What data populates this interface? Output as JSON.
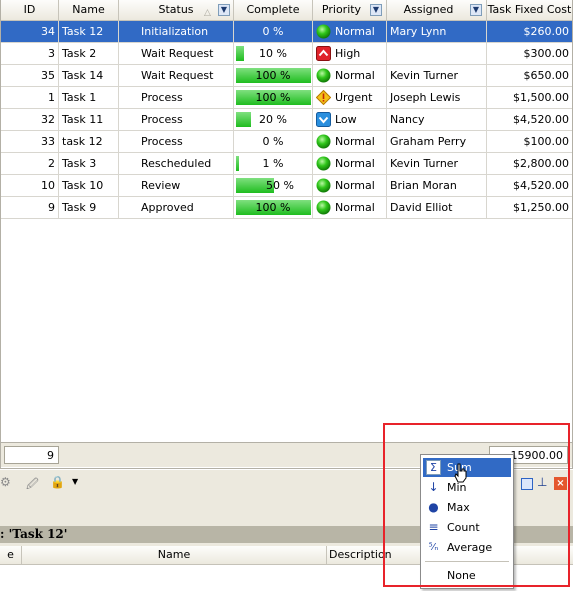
{
  "columns": [
    "ID",
    "Name",
    "Status",
    "Complete",
    "Priority",
    "Assigned",
    "Task Fixed Cost"
  ],
  "rows": [
    {
      "id": "34",
      "name": "Task 12",
      "status": "Initialization",
      "complete": "0 %",
      "pct": 0,
      "priority": "Normal",
      "pri_icon": "green-ball",
      "assigned": "Mary Lynn",
      "cost": "$260.00",
      "selected": true
    },
    {
      "id": "3",
      "name": "Task 2",
      "status": "Wait Request",
      "complete": "10 %",
      "pct": 10,
      "priority": "High",
      "pri_icon": "red-up-arrow",
      "assigned": "",
      "cost": "$300.00"
    },
    {
      "id": "35",
      "name": "Task 14",
      "status": "Wait Request",
      "complete": "100 %",
      "pct": 100,
      "priority": "Normal",
      "pri_icon": "green-ball",
      "assigned": "Kevin Turner",
      "cost": "$650.00"
    },
    {
      "id": "1",
      "name": "Task 1",
      "status": "Process",
      "complete": "100 %",
      "pct": 100,
      "priority": "Urgent",
      "pri_icon": "warning-diamond",
      "assigned": "Joseph Lewis",
      "cost": "$1,500.00"
    },
    {
      "id": "32",
      "name": "Task 11",
      "status": "Process",
      "complete": "20 %",
      "pct": 20,
      "priority": "Low",
      "pri_icon": "blue-down-arrow",
      "assigned": "Nancy",
      "cost": "$4,520.00"
    },
    {
      "id": "33",
      "name": "task 12",
      "status": "Process",
      "complete": "0 %",
      "pct": 0,
      "priority": "Normal",
      "pri_icon": "green-ball",
      "assigned": "Graham Perry",
      "cost": "$100.00"
    },
    {
      "id": "2",
      "name": "Task 3",
      "status": "Rescheduled",
      "complete": "1 %",
      "pct": 1,
      "priority": "Normal",
      "pri_icon": "green-ball",
      "assigned": "Kevin Turner",
      "cost": "$2,800.00"
    },
    {
      "id": "10",
      "name": "Task 10",
      "status": "Review",
      "complete": "50 %",
      "pct": 50,
      "priority": "Normal",
      "pri_icon": "green-ball",
      "assigned": "Brian Moran",
      "cost": "$4,520.00"
    },
    {
      "id": "9",
      "name": "Task 9",
      "status": "Approved",
      "complete": "100 %",
      "pct": 100,
      "priority": "Normal",
      "pri_icon": "green-ball",
      "assigned": "David Elliot",
      "cost": "$1,250.00"
    }
  ],
  "footer": {
    "count": "9",
    "cost_sum": "15900.00"
  },
  "panel": {
    "title": ": 'Task 12'",
    "col_name": "Name",
    "col_description": "Description",
    "col_first": "e"
  },
  "menu": {
    "items": [
      {
        "label": "Sum",
        "icon": "sigma-icon",
        "highlighted": true
      },
      {
        "label": "Min",
        "icon": "min-icon"
      },
      {
        "label": "Max",
        "icon": "max-icon"
      },
      {
        "label": "Count",
        "icon": "count-icon"
      },
      {
        "label": "Average",
        "icon": "average-icon"
      },
      {
        "label": "None",
        "icon": ""
      }
    ]
  },
  "colors": {
    "selection": "#316ac5",
    "progress": "#22c022",
    "highlight_box": "#e8232a"
  }
}
